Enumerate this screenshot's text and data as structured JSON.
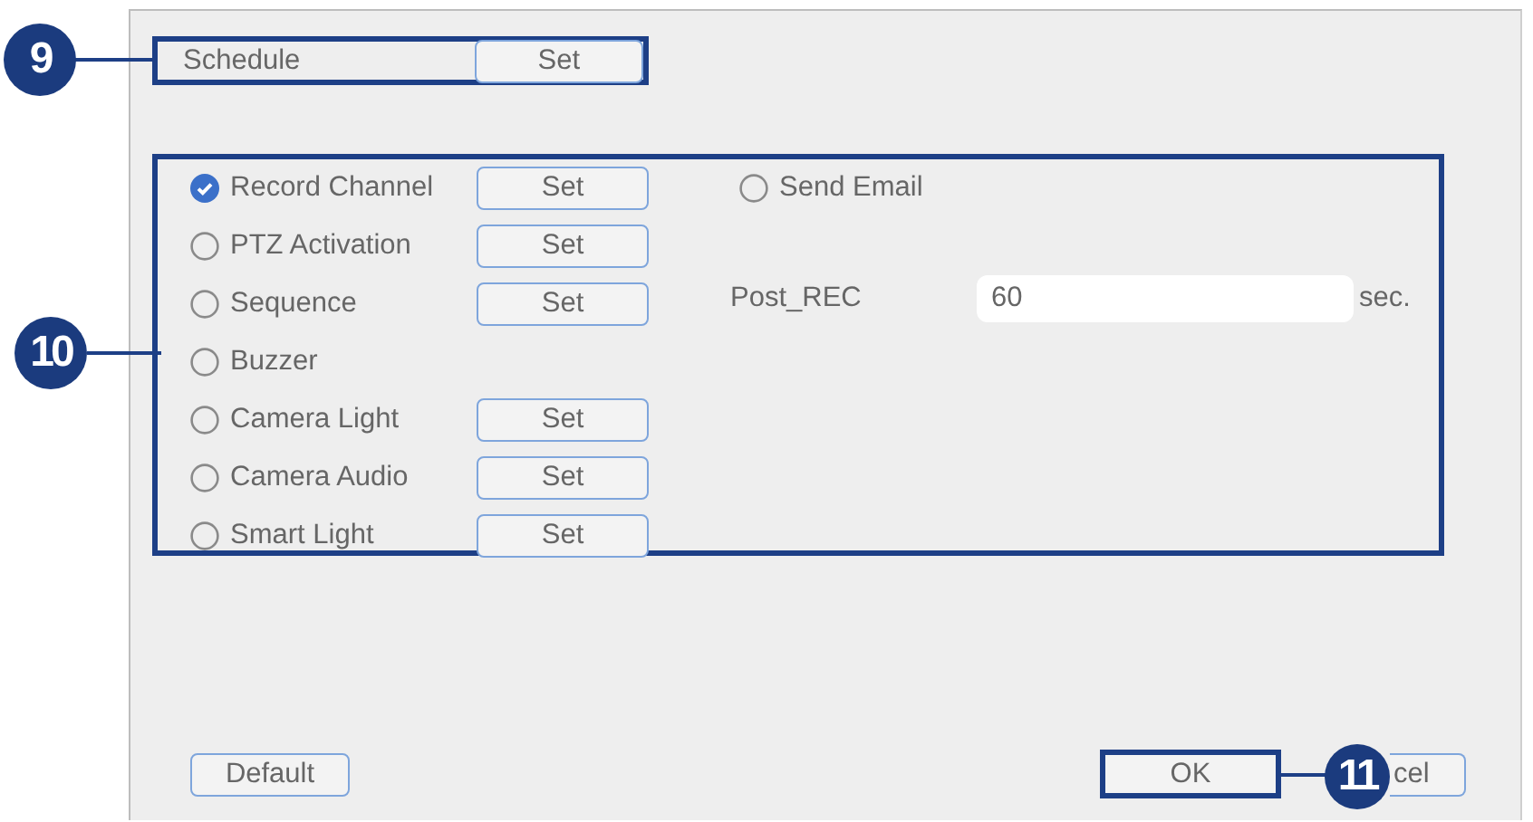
{
  "schedule": {
    "label": "Schedule",
    "button": "Set"
  },
  "actions": [
    {
      "label": "Record Channel",
      "checked": true,
      "button": "Set"
    },
    {
      "label": "PTZ Activation",
      "checked": false,
      "button": "Set"
    },
    {
      "label": "Sequence",
      "checked": false,
      "button": "Set"
    },
    {
      "label": "Buzzer",
      "checked": false
    },
    {
      "label": "Camera Light",
      "checked": false,
      "button": "Set"
    },
    {
      "label": "Camera Audio",
      "checked": false,
      "button": "Set"
    },
    {
      "label": "Smart Light",
      "checked": false,
      "button": "Set"
    }
  ],
  "send_email": {
    "label": "Send Email",
    "checked": false
  },
  "post_rec": {
    "label": "Post_REC",
    "value": "60",
    "unit": "sec."
  },
  "buttons": [
    {
      "label": "Default"
    },
    {
      "label": "OK"
    },
    {
      "label": "cel"
    }
  ],
  "callouts": [
    {
      "number": "9"
    },
    {
      "number": "10"
    },
    {
      "number": "11"
    }
  ]
}
